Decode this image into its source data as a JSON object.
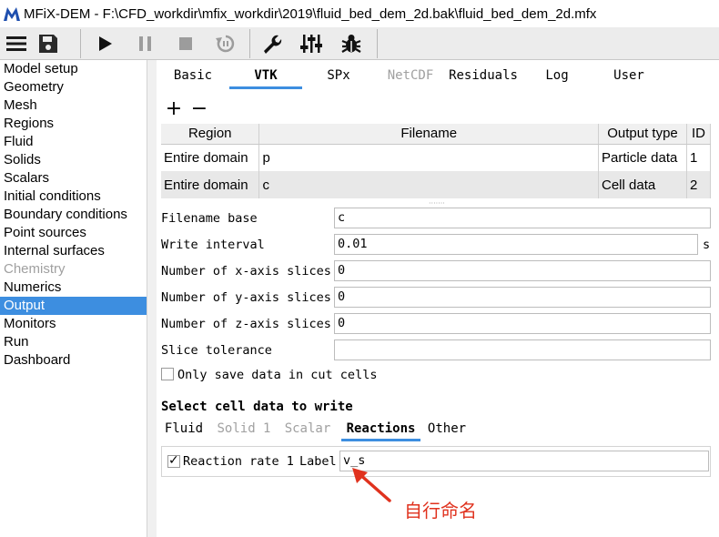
{
  "window": {
    "title": "MFiX-DEM - F:\\CFD_workdir\\mfix_workdir\\2019\\fluid_bed_dem_2d.bak\\fluid_bed_dem_2d.mfx",
    "logo_icon": "mfix-logo-icon"
  },
  "toolbar": {
    "icons": [
      "menu-icon",
      "save-icon",
      "play-icon",
      "pause-icon",
      "stop-icon",
      "reset-icon",
      "wrench-icon",
      "sliders-icon",
      "bug-icon"
    ]
  },
  "sidebar": {
    "items": [
      {
        "label": "Model setup",
        "state": "normal"
      },
      {
        "label": "Geometry",
        "state": "normal"
      },
      {
        "label": "Mesh",
        "state": "normal"
      },
      {
        "label": "Regions",
        "state": "normal"
      },
      {
        "label": "Fluid",
        "state": "normal"
      },
      {
        "label": "Solids",
        "state": "normal"
      },
      {
        "label": "Scalars",
        "state": "normal"
      },
      {
        "label": "Initial conditions",
        "state": "normal"
      },
      {
        "label": "Boundary conditions",
        "state": "normal"
      },
      {
        "label": "Point sources",
        "state": "normal"
      },
      {
        "label": "Internal surfaces",
        "state": "normal"
      },
      {
        "label": "Chemistry",
        "state": "disabled"
      },
      {
        "label": "Numerics",
        "state": "normal"
      },
      {
        "label": "Output",
        "state": "selected"
      },
      {
        "label": "Monitors",
        "state": "normal"
      },
      {
        "label": "Run",
        "state": "normal"
      },
      {
        "label": "Dashboard",
        "state": "normal"
      }
    ]
  },
  "tabs": [
    {
      "label": "Basic",
      "state": "normal"
    },
    {
      "label": "VTK",
      "state": "active"
    },
    {
      "label": "SPx",
      "state": "normal"
    },
    {
      "label": "NetCDF",
      "state": "disabled"
    },
    {
      "label": "Residuals",
      "state": "normal"
    },
    {
      "label": "Log",
      "state": "normal"
    },
    {
      "label": "User",
      "state": "normal"
    }
  ],
  "table_controls": {
    "add": "+",
    "remove": "−"
  },
  "vtk_table": {
    "columns": [
      "Region",
      "Filename",
      "Output type",
      "ID"
    ],
    "rows": [
      [
        "Entire domain",
        "p",
        "Particle data",
        "1"
      ],
      [
        "Entire domain",
        "c",
        "Cell data",
        "2"
      ]
    ]
  },
  "form": {
    "filename_base": {
      "label": "Filename base",
      "value": "c"
    },
    "write_interval": {
      "label": "Write interval",
      "value": "0.01",
      "unit": "s"
    },
    "x_slices": {
      "label": "Number of x-axis slices",
      "value": "0"
    },
    "y_slices": {
      "label": "Number of y-axis slices",
      "value": "0"
    },
    "z_slices": {
      "label": "Number of z-axis slices",
      "value": "0"
    },
    "slice_tolerance": {
      "label": "Slice tolerance",
      "value": ""
    },
    "cut_cells": {
      "label": "Only save data in cut cells",
      "checked": false
    }
  },
  "cell_data": {
    "title": "Select cell data to write",
    "subtabs": [
      {
        "label": "Fluid",
        "state": "normal"
      },
      {
        "label": "Solid 1",
        "state": "disabled"
      },
      {
        "label": "Scalar",
        "state": "disabled"
      },
      {
        "label": "Reactions",
        "state": "active"
      },
      {
        "label": "Other",
        "state": "normal"
      }
    ],
    "reaction": {
      "label": "Reaction rate 1",
      "checked": true,
      "label_caption": "Label",
      "value": "v_s"
    }
  },
  "annotation": {
    "text": "自行命名",
    "color": "#e0321e"
  },
  "colors": {
    "accent": "#3d8ee0",
    "annotation": "#e0321e"
  }
}
